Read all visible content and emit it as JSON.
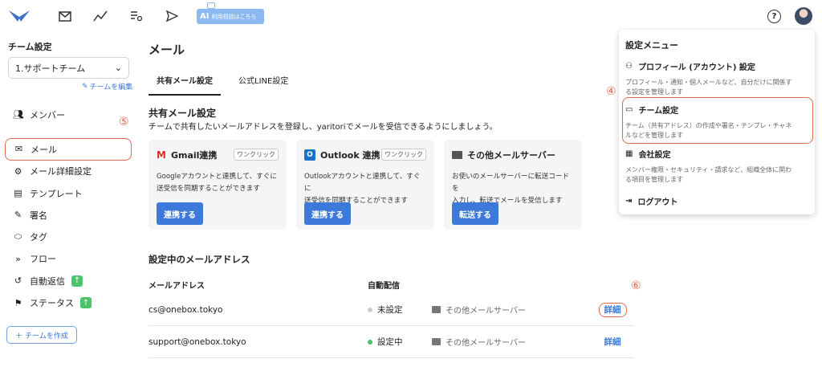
{
  "topbar": {
    "icons": [
      "logo-icon",
      "mail-icon",
      "analytics-icon",
      "list-icon",
      "send-icon"
    ],
    "ai_badge": {
      "label": "AI",
      "sub": "利用相談はこちら"
    },
    "help_label": "?"
  },
  "sidebar": {
    "title": "チーム設定",
    "team_selected": "1.サポートチーム",
    "team_edit": "チームを編集",
    "items": [
      {
        "label": "メンバー",
        "icon": "members-icon"
      },
      {
        "label": "メール",
        "icon": "mail-icon",
        "active": true
      },
      {
        "label": "メール詳細設定",
        "icon": "gear-icon"
      },
      {
        "label": "テンプレート",
        "icon": "document-icon"
      },
      {
        "label": "署名",
        "icon": "pen-icon"
      },
      {
        "label": "タグ",
        "icon": "tag-icon"
      },
      {
        "label": "フロー",
        "icon": "flow-icon"
      },
      {
        "label": "自動返信",
        "icon": "history-icon"
      },
      {
        "label": "ステータス",
        "icon": "flag-icon"
      }
    ],
    "create_team": "チームを作成",
    "annotation": "⑤"
  },
  "main": {
    "title": "メール",
    "tabs": [
      "共有メール設定",
      "公式LINE設定"
    ],
    "section_title": "共有メール設定",
    "section_desc": "チームで共有したいメールアドレスを登録し、yaritoriでメールを受信できるようにしましょう。",
    "cards": [
      {
        "title": "Gmail連携",
        "tag": "ワンクリック",
        "text1": "Googleアカウントと連携して、すぐに",
        "text2": "送受信を同期することができます",
        "button": "連携する"
      },
      {
        "title": "Outlook 連携",
        "tag": "ワンクリック",
        "text1": "Outlookアカウントと連携して、すぐに",
        "text2": "送受信を同期することができます",
        "button": "連携する"
      },
      {
        "title": "その他メールサーバー",
        "tag": "",
        "text1": "お使いのメールサーバーに転送コードを",
        "text2": "入力し、転送でメールを受信します",
        "button": "転送する"
      }
    ],
    "addr_title": "設定中のメールアドレス",
    "table": {
      "headers": [
        "メールアドレス",
        "自動配信"
      ],
      "rows": [
        {
          "email": "cs@onebox.tokyo",
          "status": "未設定",
          "status_color": "#c8cbd0",
          "server": "その他メールサーバー",
          "detail": "詳細"
        },
        {
          "email": "support@onebox.tokyo",
          "status": "設定中",
          "status_color": "#4cc36a",
          "server": "その他メールサーバー",
          "detail": "詳細"
        }
      ]
    },
    "annotation": "⑥"
  },
  "menu": {
    "title": "設定メニュー",
    "items": [
      {
        "label": "プロフィール (アカウント) 設定",
        "desc1": "プロフィール・通知・個人メールなど、自分だけに関係す",
        "desc2": "る設定を管理します"
      },
      {
        "label": "チーム設定",
        "desc1": "チーム（共有アドレス）の作成や署名・テンプレ・チャネ",
        "desc2": "ルなどを管理します"
      },
      {
        "label": "会社設定",
        "desc1": "メンバー権限・セキュリティ・請求など、組織全体に関わ",
        "desc2": "る項目を管理します"
      },
      {
        "label": "ログアウト"
      }
    ],
    "annotation": "④"
  }
}
